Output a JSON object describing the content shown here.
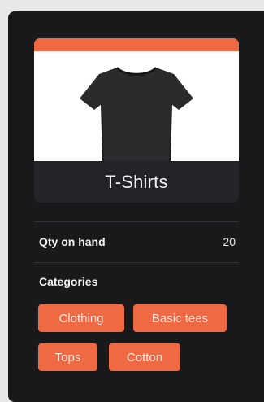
{
  "product": {
    "name": "T-Shirts",
    "image_icon": "tshirt-icon"
  },
  "stock": {
    "label": "Qty on hand",
    "value": "20"
  },
  "categories": {
    "heading": "Categories",
    "items": [
      "Clothing",
      "Basic tees",
      "Tops",
      "Cotton"
    ]
  },
  "colors": {
    "accent": "#ef6a43",
    "panel": "#19191c",
    "card": "#242428"
  }
}
